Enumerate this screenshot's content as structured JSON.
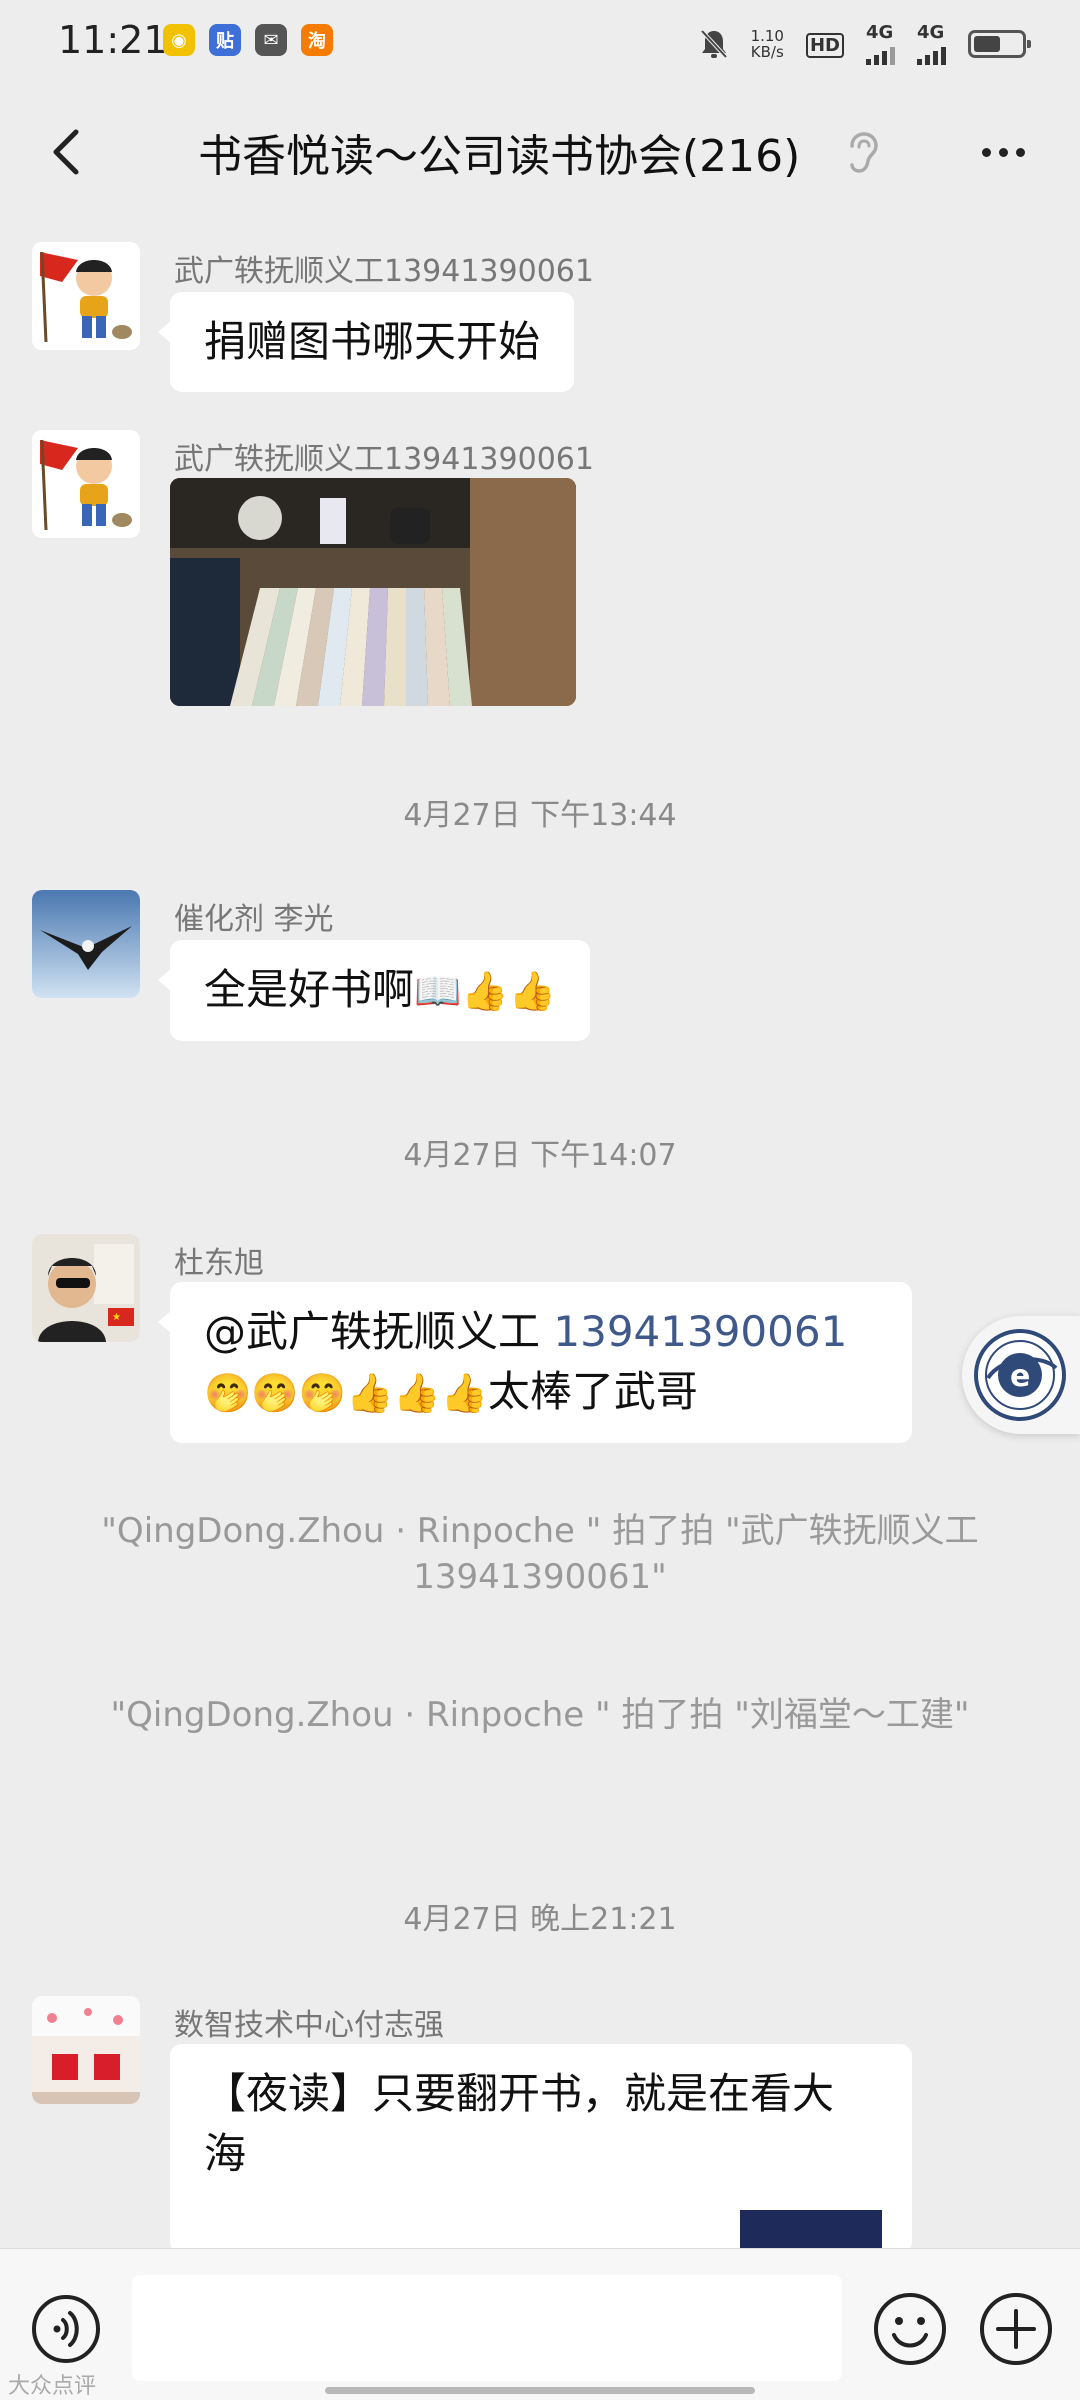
{
  "status_bar": {
    "time": "11:21",
    "speed_value": "1.10",
    "speed_unit": "KB/s",
    "hd_label": "HD",
    "net1": "4G",
    "net2": "4G",
    "app_icons": [
      "weibo-icon",
      "tieba-icon",
      "message-app-icon",
      "taobao-icon"
    ]
  },
  "header": {
    "title": "书香悦读～公司读书协会(216)",
    "back_icon": "chevron-left-icon",
    "listen_icon": "ear-icon",
    "more_icon": "more-dots-icon"
  },
  "messages": [
    {
      "sender": "武广轶抚顺义工13941390061",
      "text": "捐赠图书哪天开始"
    },
    {
      "sender": "武广轶抚顺义工13941390061",
      "image": "books-photo"
    },
    {
      "sender": "催化剂  李光",
      "text": "全是好书啊",
      "emoji": "📖👍👍"
    },
    {
      "sender": "杜东旭",
      "mention": "@武广轶抚顺义工",
      "mention_number": "13941390061",
      "line2_emoji": "🤭🤭🤭👍👍👍",
      "line2_text": "太棒了武哥"
    },
    {
      "sender": "数智技术中心付志强",
      "text": "【夜读】只要翻开书，就是在看大海"
    }
  ],
  "time_dividers": [
    "4月27日 下午13:44",
    "4月27日 下午14:07",
    "4月27日 晚上21:21"
  ],
  "system_messages": [
    "\"QingDong.Zhou  ·  Rinpoche \" 拍了拍 \"武广轶抚顺义工13941390061\"",
    "\"QingDong.Zhou  ·  Rinpoche \" 拍了拍 \"刘福堂～工建\""
  ],
  "input_bar": {
    "voice_icon": "voice-icon",
    "emoji_icon": "emoji-icon",
    "plus_icon": "plus-icon",
    "placeholder": ""
  },
  "watermark": "大众点评",
  "colors": {
    "background": "#ededed",
    "bubble": "#ffffff",
    "mention": "#3f5a8a",
    "meta_text": "#8a8a8a"
  }
}
